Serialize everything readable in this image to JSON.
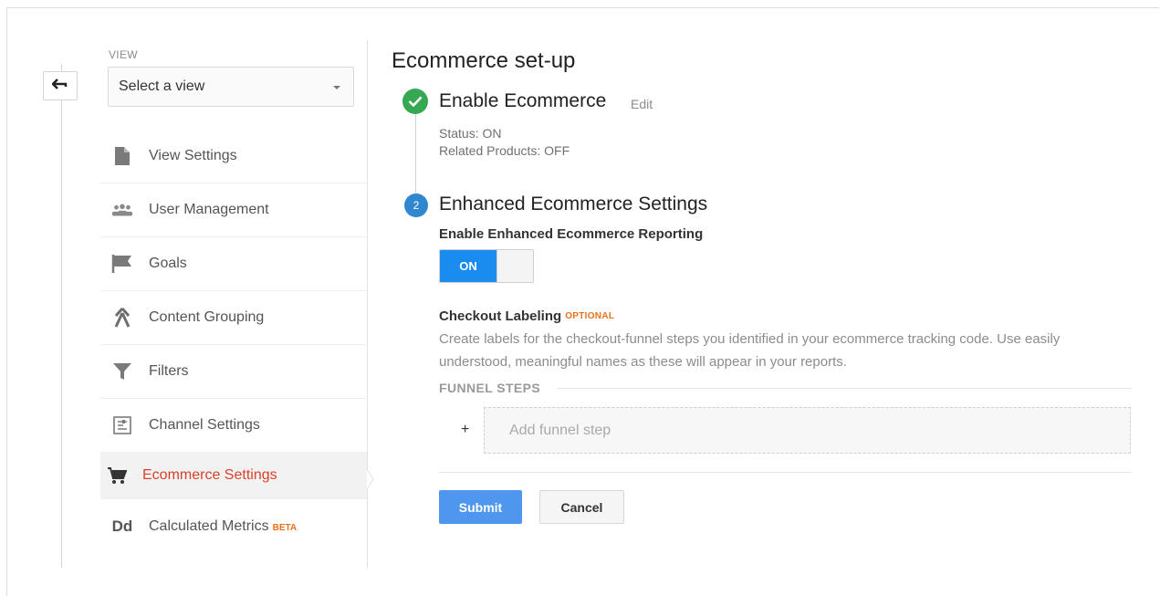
{
  "sidebar": {
    "view_label": "VIEW",
    "view_select_value": "Select a view",
    "items": [
      {
        "label": "View Settings",
        "icon": "document-icon"
      },
      {
        "label": "User Management",
        "icon": "users-icon"
      },
      {
        "label": "Goals",
        "icon": "flag-icon"
      },
      {
        "label": "Content Grouping",
        "icon": "content-grouping-icon"
      },
      {
        "label": "Filters",
        "icon": "filter-icon"
      },
      {
        "label": "Channel Settings",
        "icon": "channel-settings-icon"
      },
      {
        "label": "Ecommerce Settings",
        "icon": "cart-icon",
        "active": true
      },
      {
        "label": "Calculated Metrics",
        "icon": "calculated-metrics-icon",
        "badge": "BETA"
      }
    ]
  },
  "main": {
    "title": "Ecommerce set-up",
    "step1": {
      "title": "Enable Ecommerce",
      "edit_label": "Edit",
      "status": "Status: ON",
      "related_products": "Related Products: OFF"
    },
    "step2": {
      "number": "2",
      "title": "Enhanced Ecommerce Settings",
      "toggle_label": "Enable Enhanced Ecommerce Reporting",
      "toggle_state": "ON"
    },
    "checkout": {
      "title": "Checkout Labeling",
      "optional_badge": "OPTIONAL",
      "description": "Create labels for the checkout-funnel steps you identified in your ecommerce tracking code. Use easily understood, meaningful names as these will appear in your reports.",
      "funnel_steps_label": "FUNNEL STEPS",
      "add_step_plus": "+",
      "add_step_placeholder": "Add funnel step"
    },
    "buttons": {
      "submit": "Submit",
      "cancel": "Cancel"
    }
  },
  "colors": {
    "active_nav": "#d9412a",
    "toggle_on": "#1a8cf0",
    "submit": "#4f96ee",
    "check": "#36a852",
    "step_number": "#2f87d0",
    "badge": "#e8711c"
  }
}
